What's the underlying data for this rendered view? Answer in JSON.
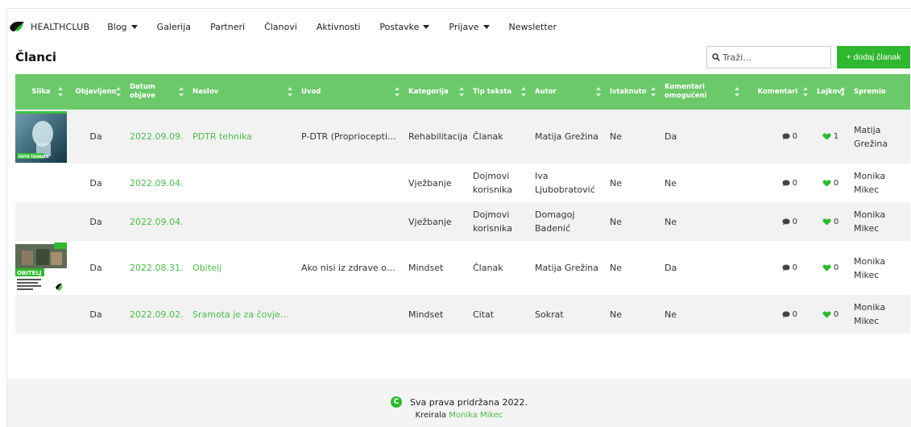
{
  "nav": {
    "brand": "HEALTHCLUB",
    "items": [
      {
        "label": "Blog",
        "dropdown": true
      },
      {
        "label": "Galerija",
        "dropdown": false
      },
      {
        "label": "Partneri",
        "dropdown": false
      },
      {
        "label": "Članovi",
        "dropdown": false
      },
      {
        "label": "Aktivnosti",
        "dropdown": false
      },
      {
        "label": "Postavke",
        "dropdown": true
      },
      {
        "label": "Prijave",
        "dropdown": true
      },
      {
        "label": "Newsletter",
        "dropdown": false
      }
    ]
  },
  "page": {
    "title": "Članci",
    "search_placeholder": "Traži...",
    "add_button": "+ dodaj članak"
  },
  "table": {
    "headers": [
      "Slika",
      "Objavljeno",
      "Datum objave",
      "Naslov",
      "Uvod",
      "Kategorija",
      "Tip teksta",
      "Autor",
      "Istaknuto",
      "Komentari omogućeni",
      "Komentari",
      "Lajkovi",
      "Spremio"
    ],
    "rows": [
      {
        "image": "pdtr",
        "published": "Da",
        "date": "2022.09.09.",
        "title": "PDTR tehnika",
        "intro": "P-DTR (Proprioceptiv…",
        "category": "Rehabilitacija",
        "type": "Članak",
        "author": "Matija Grežina",
        "featured": "Ne",
        "comments_enabled": "Da",
        "comments": "0",
        "likes": "1",
        "saved_by": "Matija Grežina"
      },
      {
        "image": "",
        "published": "Da",
        "date": "2022.09.04.",
        "title": "",
        "intro": "",
        "category": "Vježbanje",
        "type": "Dojmovi korisnika",
        "author": "Iva Ljubobratović",
        "featured": "Ne",
        "comments_enabled": "Ne",
        "comments": "0",
        "likes": "0",
        "saved_by": "Monika Mikec"
      },
      {
        "image": "",
        "published": "Da",
        "date": "2022.09.04.",
        "title": "",
        "intro": "",
        "category": "Vježbanje",
        "type": "Dojmovi korisnika",
        "author": "Domagoj Badenić",
        "featured": "Ne",
        "comments_enabled": "Ne",
        "comments": "0",
        "likes": "0",
        "saved_by": "Monika Mikec"
      },
      {
        "image": "obitelj",
        "published": "Da",
        "date": "2022.08.31.",
        "title": "Obitelj",
        "intro": "Ako nisi iz zdrave obit…",
        "category": "Mindset",
        "type": "Članak",
        "author": "Matija Grežina",
        "featured": "Ne",
        "comments_enabled": "Da",
        "comments": "0",
        "likes": "0",
        "saved_by": "Monika Mikec"
      },
      {
        "image": "",
        "published": "Da",
        "date": "2022.09.02.",
        "title": "Sramota je za čovjeka…",
        "intro": "",
        "category": "Mindset",
        "type": "Citat",
        "author": "Sokrat",
        "featured": "Ne",
        "comments_enabled": "Ne",
        "comments": "0",
        "likes": "0",
        "saved_by": "Monika Mikec"
      }
    ]
  },
  "thumbnails": {
    "pdtr_caption": "PDTR TEHNIKA",
    "obitelj_caption": "OBITELJ"
  },
  "footer": {
    "logo_letter": "C",
    "copyright": "Sva prava pridržana 2022.",
    "made_by_prefix": "Kreirala",
    "made_by_name": "Monika Mikec"
  },
  "colors": {
    "accent": "#2fb82f",
    "header_bg": "#6cc96a",
    "link": "#4cbb4a",
    "row_alt": "#f2f2f2"
  },
  "icons": {
    "logo": "healthclub-logo-icon",
    "search": "search-icon",
    "comment": "comment-icon",
    "like": "heart-icon",
    "sort": "sort-icon"
  }
}
